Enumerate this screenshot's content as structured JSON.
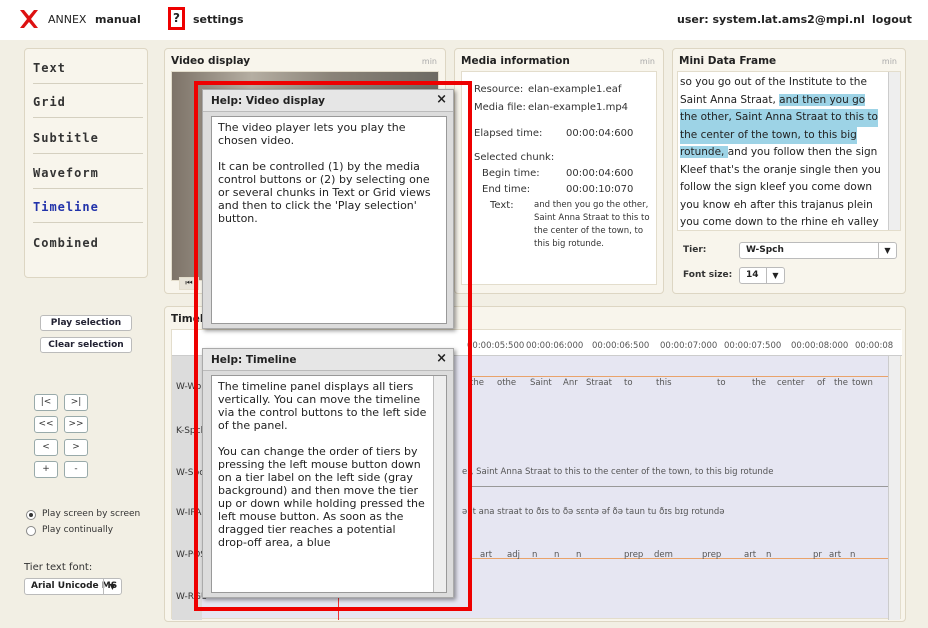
{
  "topbar": {
    "brand": "ANNEX",
    "manual": "manual",
    "help": "?",
    "settings": "settings",
    "user": "user: system.lat.ams2@mpi.nl",
    "logout": "logout"
  },
  "nav": [
    "Text",
    "Grid",
    "Subtitle",
    "Waveform",
    "Timeline",
    "Combined"
  ],
  "nav_active": "Timeline",
  "video": {
    "title": "Video display",
    "min": "min"
  },
  "media": {
    "title": "Media information",
    "min": "min",
    "resource_label": "Resource:",
    "resource": "elan-example1.eaf",
    "media_label": "Media file:",
    "media": "elan-example1.mp4",
    "elapsed_label": "Elapsed time:",
    "elapsed": "00:00:04:600",
    "chunk_label": "Selected chunk:",
    "begin_label": "Begin time:",
    "begin": "00:00:04:600",
    "end_label": "End time:",
    "end": "00:00:10:070",
    "text_label": "Text:",
    "text_lines": [
      "and then you go the other,",
      "Saint Anna Straat to this to",
      "the center of the town, to",
      "this big rotunde."
    ]
  },
  "mini": {
    "title": "Mini Data Frame",
    "min": "min",
    "lines": [
      "so you go out of the Institute to the",
      "Saint Anna Straat, ",
      "and then you go",
      "the other, Saint Anna Straat to this to",
      "the center of the town, to this big",
      "rotunde, ",
      " and you follow then the sign",
      "Kleef that's the oranje single then you",
      "follow the sign kleef you come down",
      "you know eh after this trajanus plein",
      "you come down to the rhine eh valley"
    ],
    "tier_label": "Tier:",
    "tier": "W-Spch",
    "font_label": "Font size:",
    "font": "14"
  },
  "controls": {
    "play_selection": "Play selection",
    "clear_selection": "Clear selection",
    "nav_buttons": [
      "|<",
      ">|",
      "<<",
      ">>",
      "<",
      ">",
      "+",
      "-"
    ],
    "play_screen": "Play screen by screen",
    "play_cont": "Play continually",
    "font_label": "Tier text font:",
    "font_value": "Arial Unicode MS"
  },
  "timeline": {
    "title": "Timeline",
    "times": [
      "00:00:05:500",
      "00:00:06:000",
      "00:00:06:500",
      "00:00:07:000",
      "00:00:07:500",
      "00:00:08:000",
      "00:00:08"
    ],
    "tiers": [
      "W-Wo",
      "K-Spch",
      "W-Spch",
      "W-IPA",
      "W-POS",
      "W-RGU"
    ],
    "words": [
      "the",
      "othe",
      "Saint",
      "Anr",
      "Straat",
      "to",
      "this",
      "to",
      "the",
      "center",
      "of",
      "the",
      "town"
    ],
    "spch": "er, Saint Anna Straat to this to the center of the town, to this big rotunde",
    "ipa": "ənt ana straat to ðɪs to ðə sɛntə əf ðə taun tu ðɪs bɪg rotundə",
    "pos": [
      "art",
      "adj",
      "n",
      "n",
      "n",
      "prep",
      "dem",
      "prep",
      "art",
      "n",
      "pr",
      "art",
      "n"
    ]
  },
  "help_video": {
    "title": "Help: Video display",
    "close": "×",
    "text": [
      "The video player lets you play the chosen video.",
      "It can be controlled (1) by the media control buttons or (2) by selecting one or several chunks in Text or Grid views and then to click the 'Play selection' button."
    ]
  },
  "help_timeline": {
    "title": "Help: Timeline",
    "close": "×",
    "text": [
      "The timeline panel displays all tiers vertically. You can move the timeline via the control buttons to the left side of the panel.",
      "You can change the order of tiers by pressing the left mouse button down on a tier label on the left side (gray background) and then move the tier up or down while holding pressed the left mouse button. As soon as the dragged tier reaches a potential drop-off area, a blue"
    ]
  },
  "colors": {
    "accent": "#e00000",
    "highlight": "#9dd3e6",
    "nav_active": "#2233aa"
  }
}
